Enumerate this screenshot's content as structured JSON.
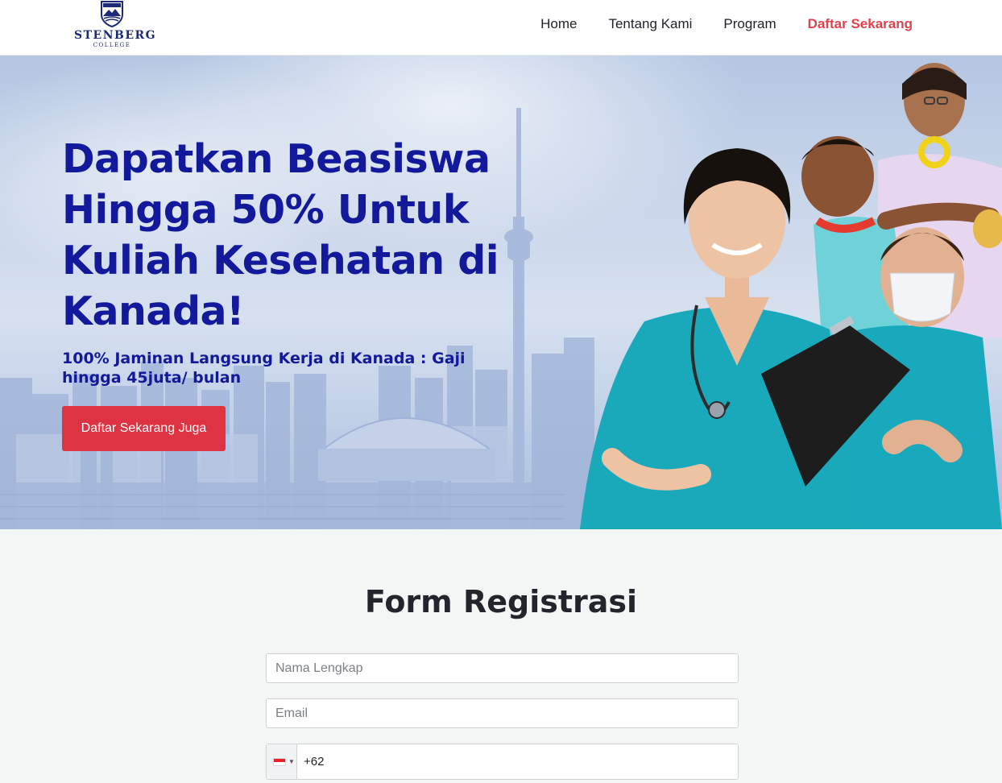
{
  "header": {
    "logo": {
      "name": "STENBERG",
      "sub": "COLLEGE"
    },
    "nav": [
      {
        "label": "Home"
      },
      {
        "label": "Tentang Kami"
      },
      {
        "label": "Program"
      },
      {
        "label": "Daftar Sekarang"
      }
    ]
  },
  "hero": {
    "title_lines": [
      "Dapatkan Beasiswa",
      "Hingga 50% Untuk",
      "Kuliah Kesehatan di",
      "Kanada!"
    ],
    "subtitle_lines": [
      "100% Jaminan Langsung Kerja di Kanada : Gaji",
      "hingga 45juta/ bulan"
    ],
    "button_label": "Daftar Sekarang Juga"
  },
  "form": {
    "title": "Form Registrasi",
    "name_placeholder": "Nama Lengkap",
    "email_placeholder": "Email",
    "phone_prefix": "+62",
    "flag": "indonesia-flag"
  },
  "colors": {
    "brand_navy": "#12199a",
    "cta_red": "#dd3342",
    "nav_cta": "#e0414e",
    "scrubs": "#19a9bd"
  }
}
